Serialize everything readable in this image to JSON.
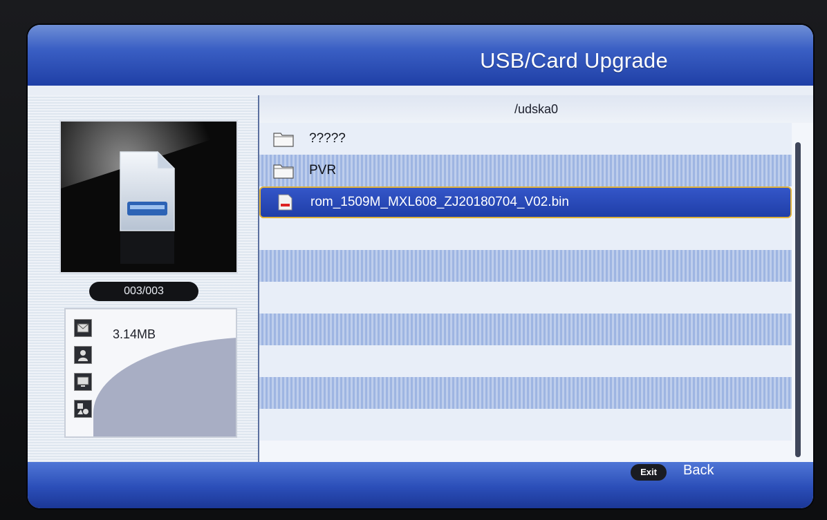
{
  "header": {
    "title": "USB/Card Upgrade"
  },
  "browser": {
    "path": "/udska0",
    "items": [
      {
        "name": "?????",
        "type": "folder"
      },
      {
        "name": "PVR",
        "type": "folder"
      },
      {
        "name": "rom_1509M_MXL608_ZJ20180704_V02.bin",
        "type": "file",
        "selected": true
      }
    ]
  },
  "left_panel": {
    "counter": "003/003",
    "file_size": "3.14MB"
  },
  "footer": {
    "exit_key": "Exit",
    "back_label": "Back"
  },
  "colors": {
    "header_blue": "#3a5fc4",
    "selection_blue": "#2a4bbd",
    "selection_border": "#e0b23a",
    "row_alt": "#a8bde6"
  }
}
